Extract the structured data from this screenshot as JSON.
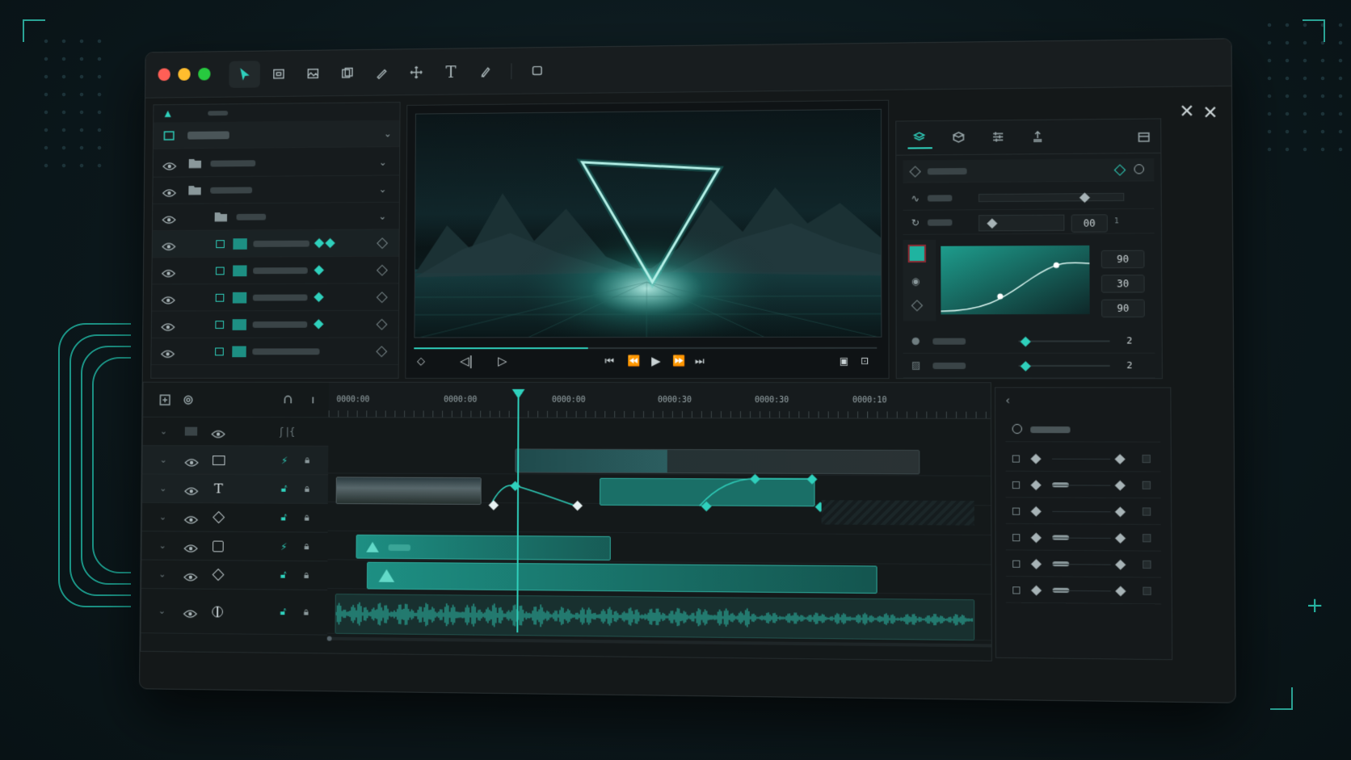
{
  "app": {
    "accent": "#2fd0bc",
    "background": "#0d1a1f"
  },
  "window": {
    "controls": [
      {
        "name": "close",
        "color": "#ff5f56"
      },
      {
        "name": "minimize",
        "color": "#ffbd2e"
      },
      {
        "name": "maximize",
        "color": "#27c93f"
      }
    ],
    "toolbar": [
      "select-arrow-icon",
      "frame-icon",
      "image-icon",
      "layers-copy-icon",
      "pen-icon",
      "move-icon",
      "text-icon",
      "brush-icon",
      "comment-icon"
    ],
    "toolbar_text_glyph": "T",
    "close_glyphs": [
      "✕",
      "✕"
    ]
  },
  "layers_panel": {
    "rows": [
      {
        "kind": "folder",
        "icon": "folder-icon"
      },
      {
        "kind": "folder-open",
        "icon": "folder-icon"
      },
      {
        "kind": "folder",
        "icon": "folder-icon"
      },
      {
        "kind": "clip",
        "icon": "image-icon",
        "keyframes": 2
      },
      {
        "kind": "clip",
        "icon": "image-icon",
        "keyframes": 1
      },
      {
        "kind": "clip",
        "icon": "image-icon",
        "keyframes": 1
      },
      {
        "kind": "clip",
        "icon": "image-icon",
        "keyframes": 1
      },
      {
        "kind": "clip",
        "icon": "image-icon",
        "keyframes": 0
      }
    ]
  },
  "viewer": {
    "scrub_progress": 0.38,
    "transport": [
      "skip-start-icon",
      "step-back-icon",
      "play-icon",
      "step-forward-icon",
      "skip-end-icon"
    ]
  },
  "properties": {
    "tabs": [
      "layers-icon",
      "stack-icon",
      "sliders-icon",
      "export-icon"
    ],
    "field_value": "00",
    "field_small": "1",
    "curve_values": [
      "90",
      "30",
      "90"
    ],
    "slider_values": [
      "2",
      "2"
    ]
  },
  "timeline": {
    "timecodes": [
      "0000:00",
      "0000:00",
      "0000:00",
      "0000:30",
      "0000:30",
      "0000:10"
    ],
    "playhead_time_fraction": 0.29,
    "tracks": [
      {
        "type": "image",
        "icon": "image-icon"
      },
      {
        "type": "text",
        "icon": "text-icon",
        "glyph": "T"
      },
      {
        "type": "shape",
        "icon": "diamond-icon"
      },
      {
        "type": "mask",
        "icon": "square-icon"
      },
      {
        "type": "shape",
        "icon": "diamond-icon"
      },
      {
        "type": "audio",
        "icon": "audio-icon"
      }
    ]
  },
  "keyframe_panel": {
    "rows": 6
  }
}
